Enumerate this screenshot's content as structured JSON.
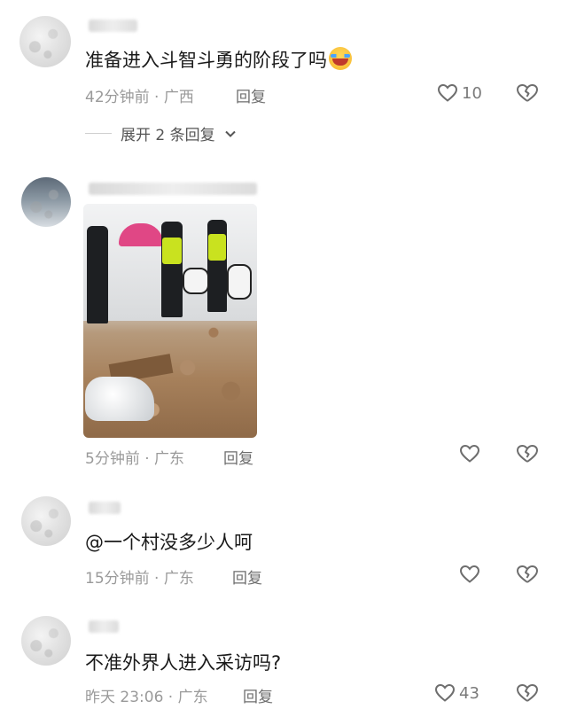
{
  "comments": [
    {
      "text": "准备进入斗智斗勇的阶段了吗",
      "emoji": "rolling-laughing-emoji",
      "meta": "42分钟前 · 广西",
      "reply_label": "回复",
      "likes": "10",
      "expand_label": "展开 2 条回复"
    },
    {
      "text": "",
      "has_image": true,
      "meta": "5分钟前 · 广东",
      "reply_label": "回复",
      "likes": ""
    },
    {
      "text": "@一个村没多少人呵",
      "meta": "15分钟前 · 广东",
      "reply_label": "回复",
      "likes": ""
    },
    {
      "text": "不准外界人进入采访吗?",
      "meta": "昨天 23:06 · 广东",
      "reply_label": "回复",
      "likes": "43"
    }
  ],
  "icons": {
    "like": "heart-outline-icon",
    "dislike": "broken-heart-icon",
    "expand": "chevron-down-icon"
  },
  "colors": {
    "text": "#1a1a1a",
    "meta": "#9a9a9a",
    "icon": "#6e6e6e"
  }
}
